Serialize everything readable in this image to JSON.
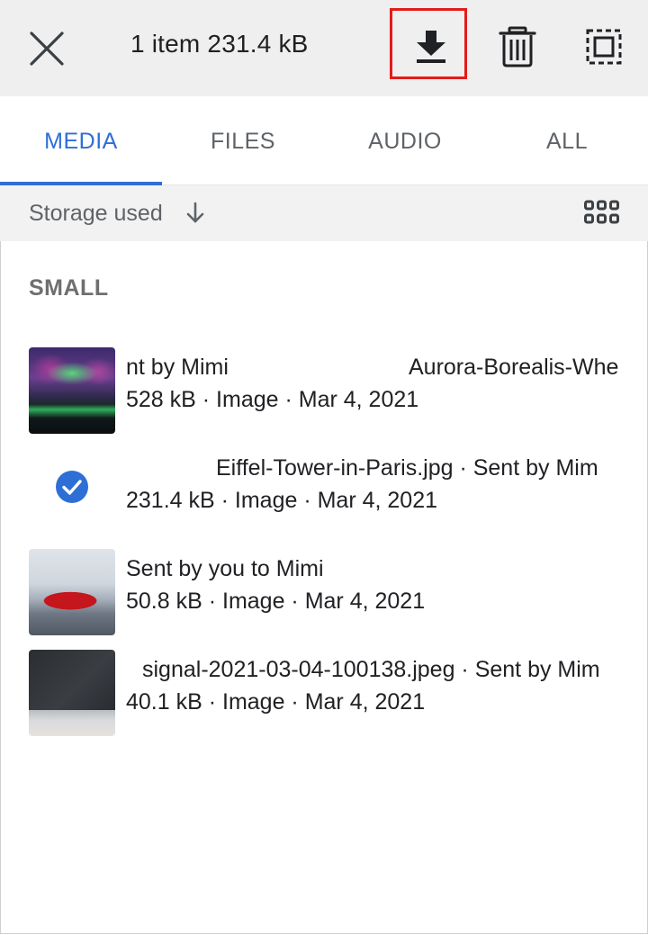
{
  "topbar": {
    "title": "1 item 231.4 kB"
  },
  "tabs": [
    {
      "label": "MEDIA",
      "active": true
    },
    {
      "label": "FILES",
      "active": false
    },
    {
      "label": "AUDIO",
      "active": false
    },
    {
      "label": "ALL",
      "active": false
    }
  ],
  "sort": {
    "label": "Storage used"
  },
  "section": {
    "header": "SMALL"
  },
  "items": [
    {
      "line1_a": "nt by Mimi",
      "line1_b": "Aurora-Borealis-Whe",
      "line2": "528 kB · Image · Mar 4, 2021",
      "thumbnail": "aurora-image",
      "selected": false
    },
    {
      "line1": "Eiffel-Tower-in-Paris.jpg · Sent by Mim",
      "line2": "231.4 kB · Image · Mar 4, 2021",
      "thumbnail": "check-icon",
      "selected": true
    },
    {
      "line1": "Sent by you to Mimi",
      "line2": "50.8 kB · Image · Mar 4, 2021",
      "thumbnail": "red-car-image",
      "selected": false
    },
    {
      "line1": "signal-2021-03-04-100138.jpeg · Sent by Mim",
      "line2": "40.1 kB · Image · Mar 4, 2021",
      "thumbnail": "laptop-image",
      "selected": false
    }
  ],
  "colors": {
    "accent": "#2e6fd6",
    "highlight_box": "#e41b1b",
    "topbar_bg": "#efefef",
    "sortbar_bg": "#f2f2f2"
  }
}
